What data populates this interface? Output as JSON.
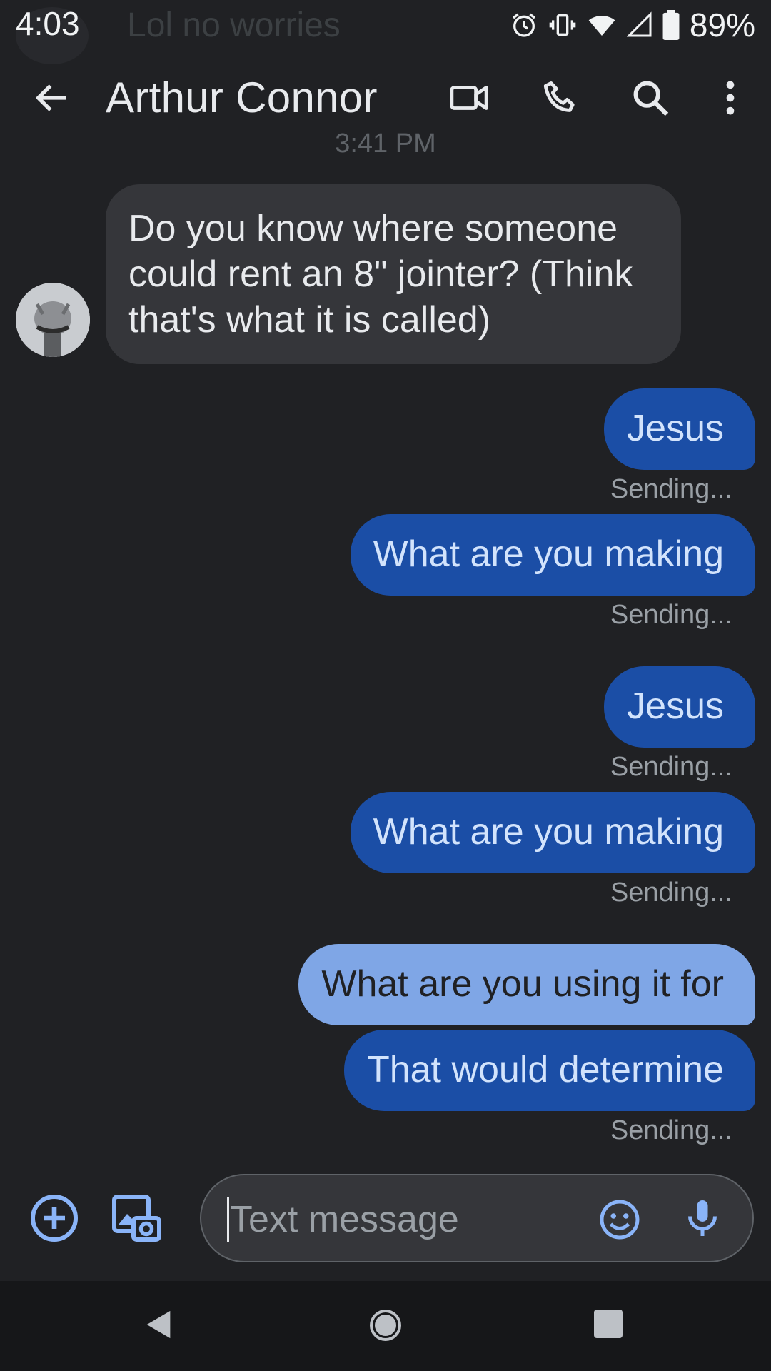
{
  "status_bar": {
    "time": "4:03",
    "notification_preview": "Lol no worries",
    "battery": "89%",
    "icons": [
      "alarm-icon",
      "vibrate-icon",
      "wifi-icon",
      "cell-signal-icon",
      "battery-icon"
    ]
  },
  "app_bar": {
    "contact_name": "Arthur Connor",
    "actions": [
      "video-call-icon",
      "phone-icon",
      "search-icon",
      "more-options-icon"
    ]
  },
  "conversation": {
    "timestamp": "3:41 PM",
    "incoming": {
      "text": "Do you know where someone could rent an 8\" jointer? (Think that's what it is called)"
    },
    "outgoing": [
      {
        "text": "Jesus",
        "status": "Sending..."
      },
      {
        "text": "What are you making",
        "status": "Sending..."
      },
      {
        "text": "Jesus",
        "status": "Sending..."
      },
      {
        "text": "What are you making",
        "status": "Sending..."
      },
      {
        "text": "What are you using it for",
        "status": ""
      },
      {
        "text": "That would determine",
        "status": "Sending..."
      }
    ]
  },
  "compose": {
    "placeholder": "Text message",
    "buttons": [
      "add-icon",
      "gallery-icon",
      "emoji-icon",
      "mic-icon"
    ]
  },
  "colors": {
    "background": "#202124",
    "incoming_bubble": "#35363a",
    "outgoing_bubble": "#1b4ea6",
    "outgoing_bubble_selected": "#7fa6e6",
    "accent": "#8ab4f8"
  }
}
